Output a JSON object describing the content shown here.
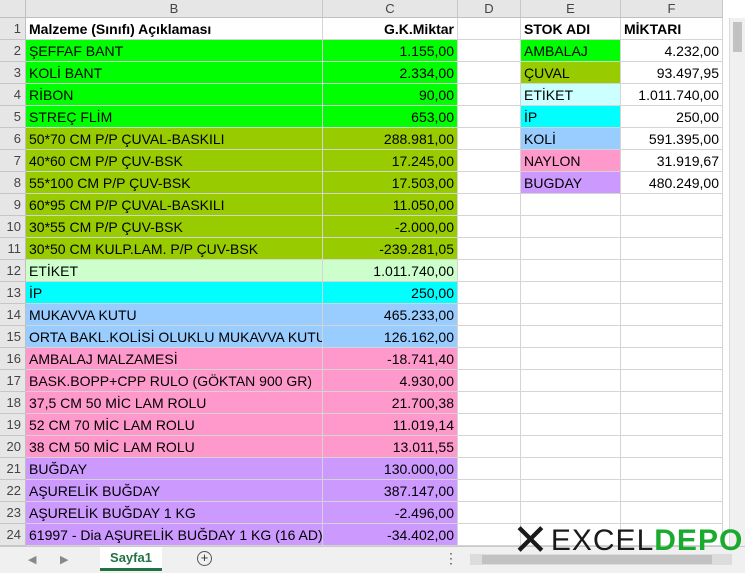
{
  "columns": [
    "B",
    "C",
    "D",
    "E",
    "F"
  ],
  "row_numbers": [
    "1",
    "2",
    "3",
    "4",
    "5",
    "6",
    "7",
    "8",
    "9",
    "10",
    "11",
    "12",
    "13",
    "14",
    "15",
    "16",
    "17",
    "18",
    "19",
    "20",
    "21",
    "22",
    "23",
    "24"
  ],
  "left_table": {
    "header": {
      "description": "Malzeme (Sınıfı) Açıklaması",
      "quantity": "G.K.Miktar"
    },
    "rows": [
      {
        "description": "ŞEFFAF BANT",
        "quantity": "1.155,00",
        "color": "#00ff00"
      },
      {
        "description": "KOLİ BANT",
        "quantity": "2.334,00",
        "color": "#00ff00"
      },
      {
        "description": "RİBON",
        "quantity": "90,00",
        "color": "#00ff00"
      },
      {
        "description": "STREÇ FLİM",
        "quantity": "653,00",
        "color": "#00ff00"
      },
      {
        "description": "50*70 CM P/P ÇUVAL-BASKILI",
        "quantity": "288.981,00",
        "color": "#99cc00"
      },
      {
        "description": "40*60 CM P/P ÇUV-BSK",
        "quantity": "17.245,00",
        "color": "#99cc00"
      },
      {
        "description": "55*100 CM P/P ÇUV-BSK",
        "quantity": "17.503,00",
        "color": "#99cc00"
      },
      {
        "description": "60*95 CM P/P ÇUVAL-BASKILI",
        "quantity": "11.050,00",
        "color": "#99cc00"
      },
      {
        "description": "30*55 CM P/P ÇUV-BSK",
        "quantity": "-2.000,00",
        "color": "#99cc00"
      },
      {
        "description": "30*50 CM KULP.LAM. P/P ÇUV-BSK",
        "quantity": "-239.281,05",
        "color": "#99cc00"
      },
      {
        "description": "ETİKET",
        "quantity": "1.011.740,00",
        "color": "#ccffcc"
      },
      {
        "description": "İP",
        "quantity": "250,00",
        "color": "#00ffff"
      },
      {
        "description": "MUKAVVA KUTU",
        "quantity": "465.233,00",
        "color": "#99ccff"
      },
      {
        "description": "ORTA BAKL.KOLİSİ  OLUKLU MUKAVVA KUTU",
        "quantity": "126.162,00",
        "color": "#99ccff"
      },
      {
        "description": "AMBALAJ MALZAMESİ",
        "quantity": "-18.741,40",
        "color": "#ff99cc"
      },
      {
        "description": "BASK.BOPP+CPP  RULO (GÖKTAN 900 GR)",
        "quantity": "4.930,00",
        "color": "#ff99cc"
      },
      {
        "description": "37,5 CM 50 MİC LAM ROLU",
        "quantity": "21.700,38",
        "color": "#ff99cc"
      },
      {
        "description": "52 CM 70 MİC LAM ROLU",
        "quantity": "11.019,14",
        "color": "#ff99cc"
      },
      {
        "description": "38 CM 50 MİC LAM ROLU",
        "quantity": "13.011,55",
        "color": "#ff99cc"
      },
      {
        "description": "BUĞDAY",
        "quantity": "130.000,00",
        "color": "#cc99ff"
      },
      {
        "description": "AŞURELİK  BUĞDAY",
        "quantity": "387.147,00",
        "color": "#cc99ff"
      },
      {
        "description": "AŞURELİK BUĞDAY 1 KG",
        "quantity": "-2.496,00",
        "color": "#cc99ff"
      },
      {
        "description": "61997 - Dia  AŞURELİK BUĞDAY 1 KG (16 AD)",
        "quantity": "-34.402,00",
        "color": "#cc99ff"
      }
    ]
  },
  "right_table": {
    "header": {
      "name": "STOK ADI",
      "quantity": "MİKTARI"
    },
    "rows": [
      {
        "name": "AMBALAJ",
        "quantity": "4.232,00",
        "color": "#00ff00"
      },
      {
        "name": "ÇUVAL",
        "quantity": "93.497,95",
        "color": "#99cc00"
      },
      {
        "name": "ETİKET",
        "quantity": "1.011.740,00",
        "color": "#ccffff"
      },
      {
        "name": "İP",
        "quantity": "250,00",
        "color": "#00ffff"
      },
      {
        "name": "KOLİ",
        "quantity": "591.395,00",
        "color": "#99ccff"
      },
      {
        "name": "NAYLON",
        "quantity": "31.919,67",
        "color": "#ff99cc"
      },
      {
        "name": "BUGDAY",
        "quantity": "480.249,00",
        "color": "#cc99ff"
      }
    ]
  },
  "status_bar": {
    "prev_icon": "triangle-left-icon",
    "next_icon": "triangle-right-icon",
    "sheet_tab": "Sayfa1",
    "add_sheet_icon": "plus-circle-icon",
    "options_icon": "vertical-dots-icon"
  },
  "watermark": {
    "left_word": "EXCEL",
    "right_word": "DEPO"
  },
  "accent_color": "#217346"
}
